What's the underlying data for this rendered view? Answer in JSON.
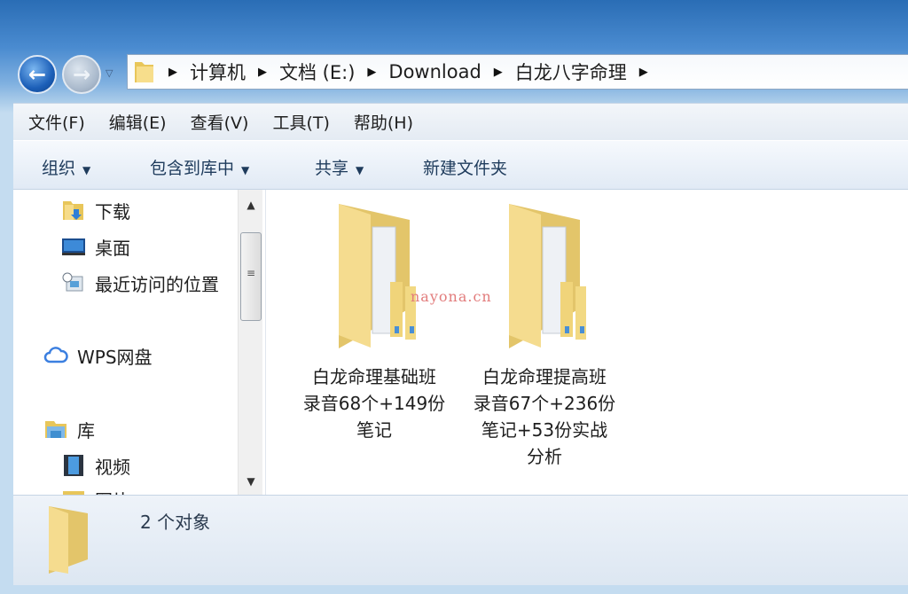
{
  "navigation": {
    "back": "back-arrow-icon",
    "forward": "forward-arrow-icon"
  },
  "address_bar": {
    "crumbs": [
      "计算机",
      "文档 (E:)",
      "Download",
      "白龙八字命理"
    ]
  },
  "menu": [
    "文件(F)",
    "编辑(E)",
    "查看(V)",
    "工具(T)",
    "帮助(H)"
  ],
  "toolbar": {
    "organize": "组织",
    "include_library": "包含到库中",
    "share": "共享",
    "new_folder": "新建文件夹"
  },
  "sidebar": {
    "items": [
      {
        "label": "下载",
        "icon": "downloads-folder-icon"
      },
      {
        "label": "桌面",
        "icon": "desktop-icon"
      },
      {
        "label": "最近访问的位置",
        "icon": "recent-places-icon"
      },
      {
        "label": "WPS网盘",
        "icon": "cloud-icon"
      },
      {
        "label": "库",
        "icon": "library-icon"
      },
      {
        "label": "视频",
        "icon": "video-icon"
      },
      {
        "label": "图片",
        "icon": "pictures-icon"
      }
    ]
  },
  "files": [
    {
      "name_lines": [
        "白龙命理基础班",
        "录音68个+149份",
        "笔记"
      ]
    },
    {
      "name_lines": [
        "白龙命理提高班",
        "录音67个+236份",
        "笔记+53份实战",
        "分析"
      ]
    }
  ],
  "watermark": "nayona.cn",
  "status": {
    "count": "2 个对象"
  },
  "colors": {
    "folder": "#f3d98a",
    "frame": "#2a6db5"
  }
}
